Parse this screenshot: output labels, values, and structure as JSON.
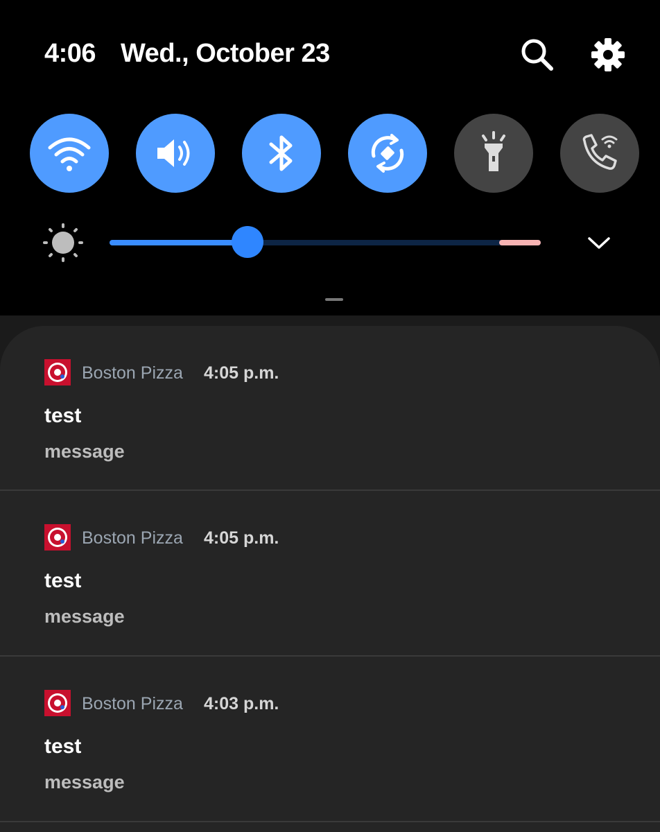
{
  "status": {
    "time": "4:06",
    "date": "Wed., October 23"
  },
  "top_icons": [
    "search-icon",
    "gear-icon"
  ],
  "quick_tiles": [
    {
      "name": "wifi",
      "icon": "wifi-icon",
      "state": "on"
    },
    {
      "name": "sound",
      "icon": "volume-icon",
      "state": "on"
    },
    {
      "name": "bluetooth",
      "icon": "bluetooth-icon",
      "state": "on"
    },
    {
      "name": "auto-rotate",
      "icon": "rotate-icon",
      "state": "on"
    },
    {
      "name": "flashlight",
      "icon": "flashlight-icon",
      "state": "off"
    },
    {
      "name": "wifi-calling",
      "icon": "wifi-call-icon",
      "state": "off"
    }
  ],
  "brightness": {
    "level": 0.32,
    "icon": "sun-icon"
  },
  "colors": {
    "accent": "#4f9bff",
    "tile_off": "#444444",
    "sheet": "#252525",
    "app_red": "#c8102e"
  },
  "notifications": [
    {
      "app": "Boston Pizza",
      "time": "4:05 p.m.",
      "title": "test",
      "body": "message"
    },
    {
      "app": "Boston Pizza",
      "time": "4:05 p.m.",
      "title": "test",
      "body": "message"
    },
    {
      "app": "Boston Pizza",
      "time": "4:03 p.m.",
      "title": "test",
      "body": "message"
    }
  ]
}
